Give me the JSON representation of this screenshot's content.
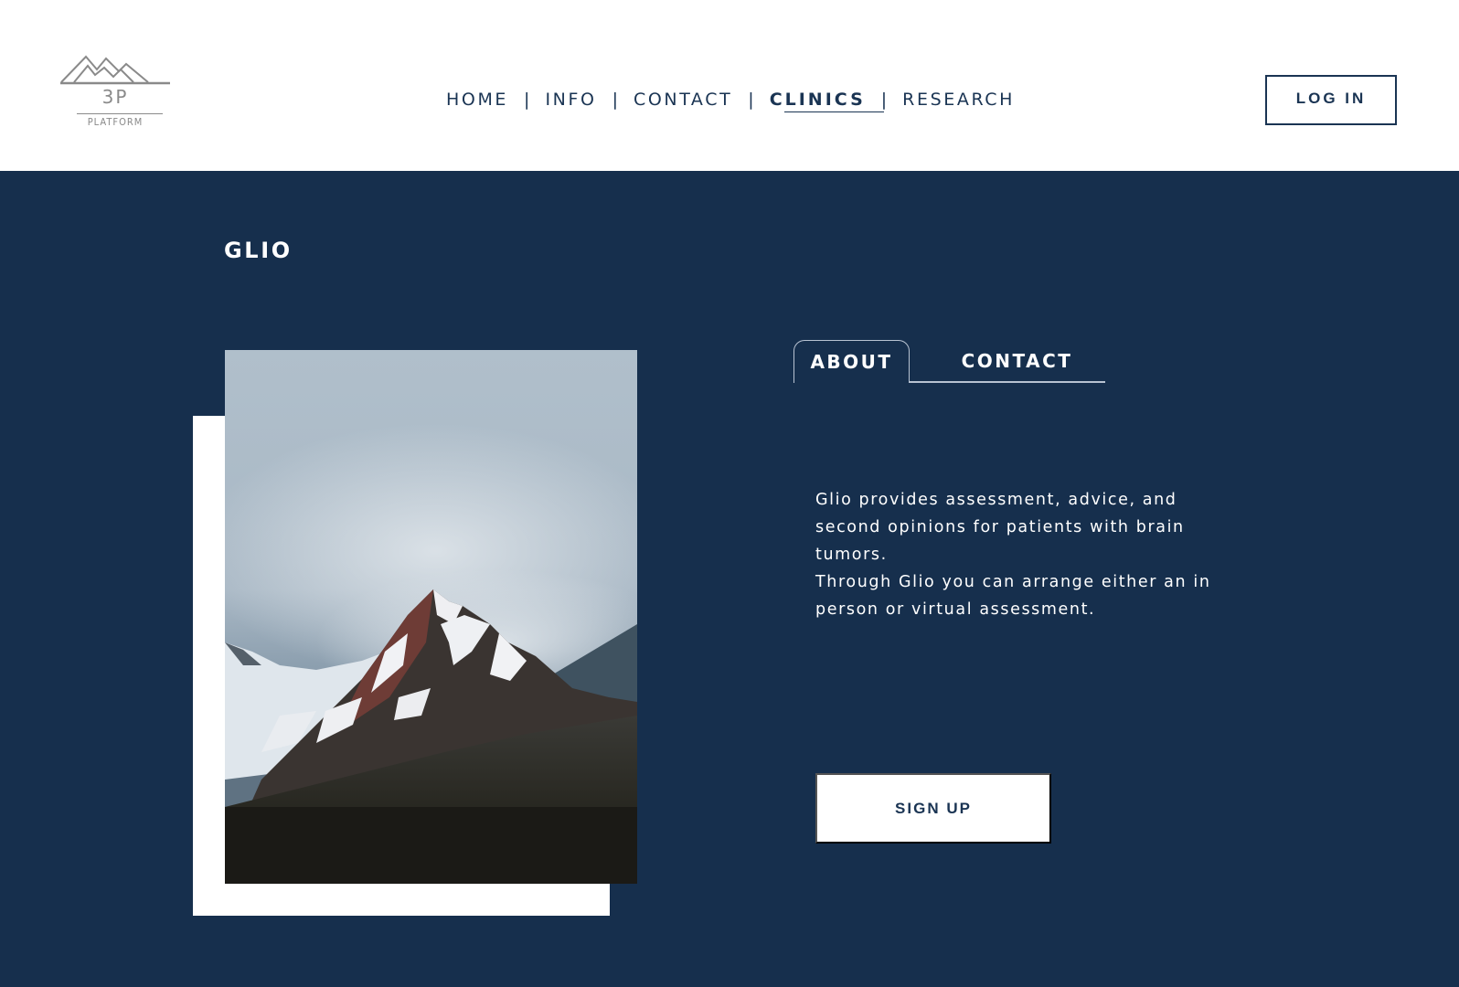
{
  "logo": {
    "brand": "3P",
    "subtitle": "PLATFORM"
  },
  "nav": {
    "items": [
      {
        "label": "HOME"
      },
      {
        "label": "INFO"
      },
      {
        "label": "CONTACT"
      },
      {
        "label": "CLINICS",
        "active": true
      },
      {
        "label": "RESEARCH"
      }
    ],
    "separator": "|"
  },
  "header": {
    "login_label": "LOG IN"
  },
  "main": {
    "title": "GLIO",
    "tabs": [
      {
        "label": "ABOUT",
        "active": true
      },
      {
        "label": "CONTACT",
        "active": false
      }
    ],
    "description": [
      "Glio provides assessment, advice, and second opinions for patients with brain tumors.",
      "Through Glio you can arrange either an in person or virtual assessment."
    ],
    "signup_label": "SIGN UP",
    "image": "mountain-photo"
  },
  "colors": {
    "navy": "#162f4d",
    "nav_text": "#1a3453",
    "white": "#ffffff",
    "logo_gray": "#8a8a8a"
  }
}
